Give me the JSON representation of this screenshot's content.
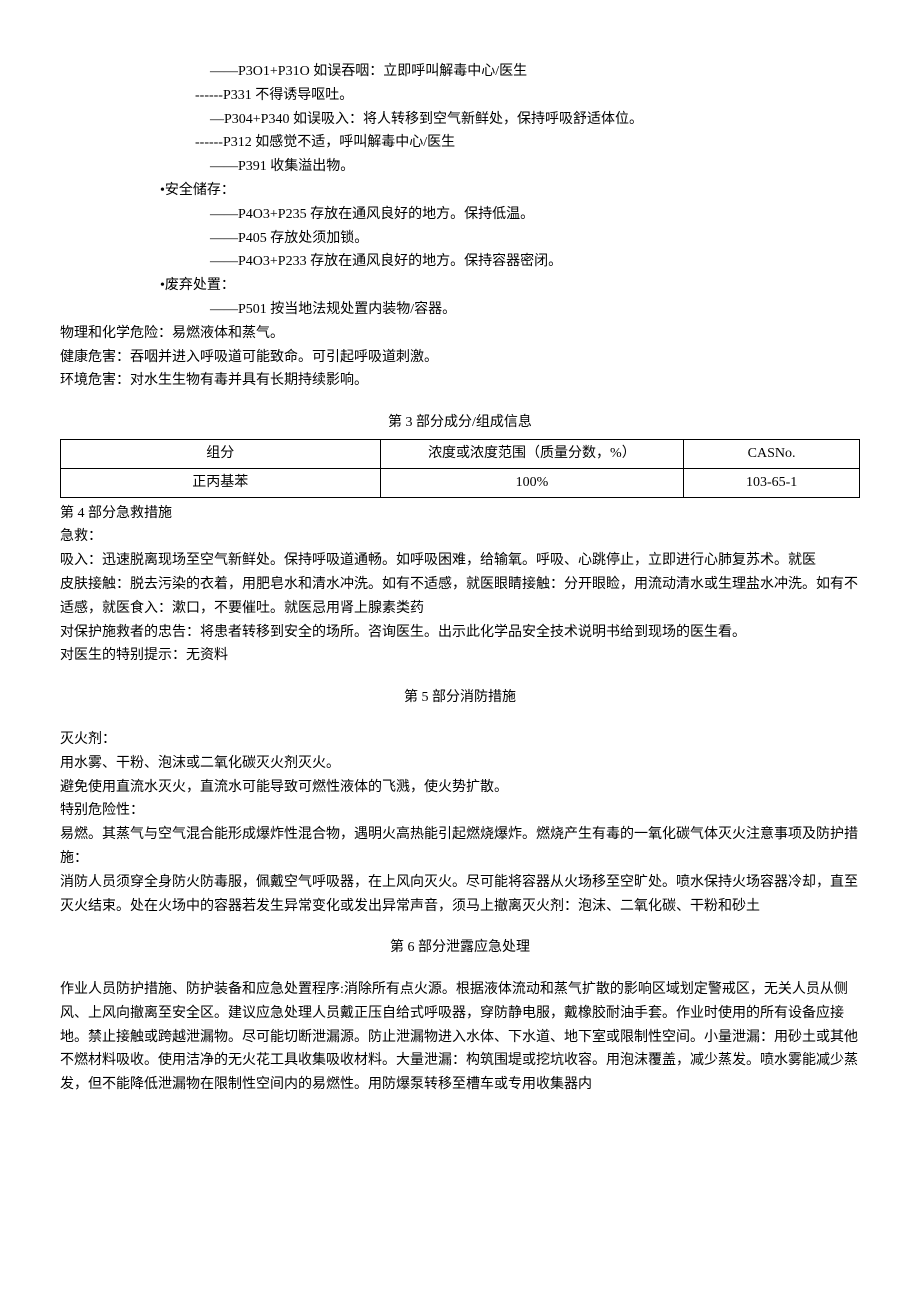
{
  "precautions": {
    "items": [
      {
        "indent": "indent2",
        "text": "——P3O1+P31O 如误吞咽：立即呼叫解毒中心/医生"
      },
      {
        "indent": "indent3",
        "text": "------P331 不得诱导呕吐。"
      },
      {
        "indent": "indent2",
        "text": "—P304+P340 如误吸入：将人转移到空气新鲜处，保持呼吸舒适体位。"
      },
      {
        "indent": "indent3",
        "text": "------P312 如感觉不适，呼叫解毒中心/医生"
      },
      {
        "indent": "indent2",
        "text": "——P391 收集溢出物。"
      }
    ],
    "storage_label": "•安全储存：",
    "storage_items": [
      "——P4O3+P235 存放在通风良好的地方。保持低温。",
      "——P405 存放处须加锁。",
      "——P4O3+P233 存放在通风良好的地方。保持容器密闭。"
    ],
    "disposal_label": "•废弃处置：",
    "disposal_items": [
      "——P501 按当地法规处置内装物/容器。"
    ]
  },
  "hazards": {
    "physical": "物理和化学危险：易燃液体和蒸气。",
    "health": "健康危害：吞咽并进入呼吸道可能致命。可引起呼吸道刺激。",
    "environment": "环境危害：对水生生物有毒并具有长期持续影响。"
  },
  "section3": {
    "heading": "第 3 部分成分/组成信息",
    "headers": {
      "component": "组分",
      "concentration": "浓度或浓度范围（质量分数，%）",
      "cas": "CASNo."
    },
    "rows": [
      {
        "component": "正丙基苯",
        "concentration": "100%",
        "cas": "103-65-1"
      }
    ]
  },
  "section4": {
    "heading": "第 4 部分急救措施",
    "first_aid_label": "急救：",
    "inhalation": "吸入：迅速脱离现场至空气新鲜处。保持呼吸道通畅。如呼吸困难，给输氧。呼吸、心跳停止，立即进行心肺复苏术。就医",
    "skin": "皮肤接触：脱去污染的衣着，用肥皂水和清水冲洗。如有不适感，就医眼睛接触：分开眼睑，用流动清水或生理盐水冲洗。如有不适感，就医食入：漱口，不要催吐。就医忌用肾上腺素类药",
    "rescuer": "对保护施救者的忠告：将患者转移到安全的场所。咨询医生。出示此化学品安全技术说明书给到现场的医生看。",
    "doctor": "对医生的特别提示：无资料"
  },
  "section5": {
    "heading": "第 5 部分消防措施",
    "extinguish_label": "灭火剂：",
    "line1": "用水雾、干粉、泡沫或二氧化碳灭火剂灭火。",
    "line2": "避免使用直流水灭火，直流水可能导致可燃性液体的飞溅，使火势扩散。",
    "danger_label": "特别危险性：",
    "danger_text": "易燃。其蒸气与空气混合能形成爆炸性混合物，遇明火高热能引起燃烧爆炸。燃烧产生有毒的一氧化碳气体灭火注意事项及防护措施：",
    "fire_text": "消防人员须穿全身防火防毒服，佩戴空气呼吸器，在上风向灭火。尽可能将容器从火场移至空旷处。喷水保持火场容器冷却，直至灭火结束。处在火场中的容器若发生异常变化或发出异常声音，须马上撤离灭火剂：泡沫、二氧化碳、干粉和砂土"
  },
  "section6": {
    "heading": "第 6 部分泄露应急处理",
    "text": "作业人员防护措施、防护装备和应急处置程序:消除所有点火源。根据液体流动和蒸气扩散的影响区域划定警戒区，无关人员从侧风、上风向撤离至安全区。建议应急处理人员戴正压自给式呼吸器，穿防静电服，戴橡胶耐油手套。作业时使用的所有设备应接地。禁止接触或跨越泄漏物。尽可能切断泄漏源。防止泄漏物进入水体、下水道、地下室或限制性空间。小量泄漏：用砂土或其他不燃材料吸收。使用洁净的无火花工具收集吸收材料。大量泄漏：构筑围堤或挖坑收容。用泡沫覆盖，减少蒸发。喷水雾能减少蒸发，但不能降低泄漏物在限制性空间内的易燃性。用防爆泵转移至槽车或专用收集器内"
  }
}
